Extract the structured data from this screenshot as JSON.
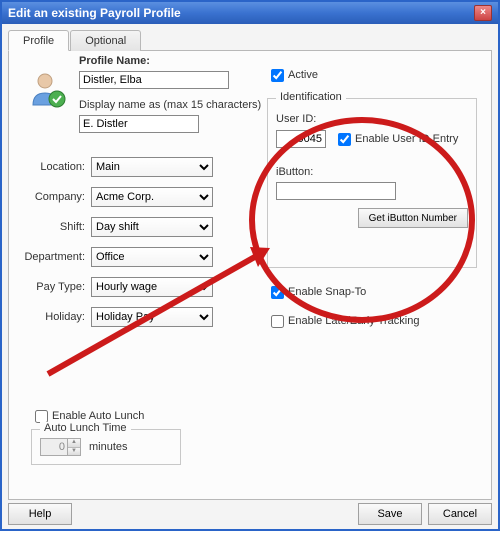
{
  "window": {
    "title": "Edit an existing Payroll Profile",
    "close_label": "×"
  },
  "tabs": {
    "profile": "Profile",
    "optional": "Optional"
  },
  "left": {
    "profile_name_label": "Profile Name:",
    "profile_name_value": "Distler, Elba",
    "display_name_label": "Display name as (max 15 characters)",
    "display_name_value": "E. Distler",
    "location_label": "Location:",
    "location_value": "Main",
    "company_label": "Company:",
    "company_value": "Acme Corp.",
    "shift_label": "Shift:",
    "shift_value": "Day shift",
    "department_label": "Department:",
    "department_value": "Office",
    "paytype_label": "Pay Type:",
    "paytype_value": "Hourly wage",
    "holiday_label": "Holiday:",
    "holiday_value": "Holiday Pay"
  },
  "right": {
    "active_label": "Active",
    "identification_legend": "Identification",
    "user_id_label": "User ID:",
    "user_id_value": "0045",
    "enable_user_id_entry_label": "Enable User ID Entry",
    "ibutton_label": "iButton:",
    "ibutton_value": "",
    "get_ibutton_label": "Get iButton Number",
    "enable_snap_label": "Enable Snap-To",
    "enable_late_label": "Enable Late/Early Tracking"
  },
  "autolunch": {
    "enable_label": "Enable Auto Lunch",
    "legend": "Auto Lunch Time",
    "value": "0",
    "unit": "minutes"
  },
  "footer": {
    "help": "Help",
    "save": "Save",
    "cancel": "Cancel"
  },
  "annotation": {
    "color": "#cc1b1b"
  }
}
